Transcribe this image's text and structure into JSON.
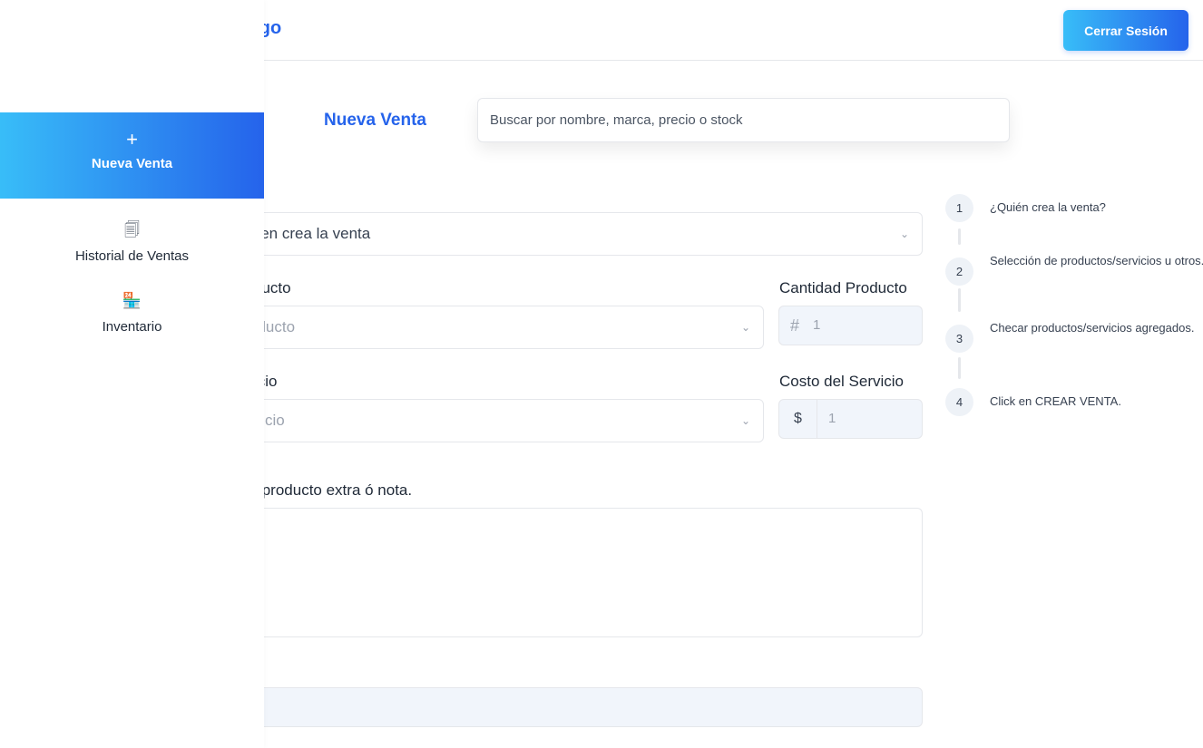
{
  "header": {
    "brand": "rgo",
    "logout_label": "Cerrar Sesión"
  },
  "sidebar": {
    "active": {
      "icon": "+",
      "label": "Nueva Venta"
    },
    "items": [
      {
        "icon_name": "receipts-icon",
        "icon": "🗐",
        "label": "Historial de Ventas"
      },
      {
        "icon_name": "store-icon",
        "icon": "🏪",
        "label": "Inventario"
      }
    ]
  },
  "main": {
    "title": "Nueva Venta",
    "search_placeholder": "Buscar por nombre, marca, precio o stock",
    "creator_select": "uien crea la venta",
    "product_label": "ducto",
    "product_select": "oducto",
    "quantity_label": "Cantidad Producto",
    "quantity_prefix": "#",
    "quantity_value": "1",
    "service_label": "icio",
    "service_select": "rvicio",
    "service_cost_label": "Costo del Servicio",
    "service_cost_prefix": "$",
    "service_cost_value": "1",
    "note_label": "/producto extra ó nota."
  },
  "steps": [
    {
      "number": "1",
      "text": "¿Quién crea la venta?"
    },
    {
      "number": "2",
      "text": "Selección de productos/servicios u otros."
    },
    {
      "number": "3",
      "text": "Checar productos/servicios agregados."
    },
    {
      "number": "4",
      "text": "Click en CREAR VENTA."
    }
  ],
  "colors": {
    "accent": "#2563eb",
    "gradient_start": "#38bdf8",
    "gradient_end": "#2563eb"
  }
}
